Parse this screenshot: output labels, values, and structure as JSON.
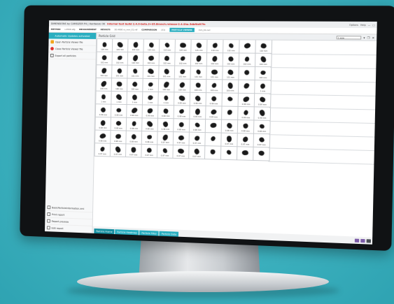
{
  "titlebar": {
    "title": "DIMENSIONS by CAMSIZER P4 | Hardware OK",
    "warning": "internal test build 2.4.0-beta.3+35.Branch.release-2.4.Sha.5dbf0d97fc",
    "options": "Options",
    "help": "Help"
  },
  "menubar": {
    "method_label": "METHOD",
    "method_value": "v.4500.afg",
    "measurement_label": "MEASUREMENT",
    "results_label": "RESULTS",
    "results_value": "20.4900 rs_mm_01.rdf",
    "comparison_label": "COMPARISON",
    "comparison_value": "(31)",
    "active_tab": "PARTICLE VIEWER",
    "active_file": "mm_01.rsd"
  },
  "sidebar": {
    "header": "Automatic Updates activated",
    "items": [
      {
        "label": "Open Particle Viewer file",
        "icon": "folder-icon"
      },
      {
        "label": "Close Particle Viewer file",
        "icon": "close-icon"
      },
      {
        "label": "Export all particles",
        "icon": "export-icon"
      }
    ],
    "bottom_items": [
      {
        "label": "BasicParticleInformation.xml",
        "icon": "document-icon"
      },
      {
        "label": "Print report",
        "icon": "print-icon"
      },
      {
        "label": "Report preview",
        "icon": "preview-icon"
      },
      {
        "label": "Edit report",
        "icon": "edit-icon"
      }
    ]
  },
  "main": {
    "title": "Particle Grid",
    "zoom_value": "1 size",
    "cell_labels": [
      "104 mm",
      "104 mm",
      "102 mm",
      "110 mm",
      "110 mm",
      "104 mm",
      "115 mm",
      "119 mm",
      "132 mm",
      "",
      "102 mm",
      "102 mm",
      "102 mm",
      "102 mm",
      "102 mm",
      "102 mm",
      "102 mm",
      "102 mm",
      "102 mm",
      "102 mm",
      "102 mm",
      "102 mm",
      "102 mm",
      "101 mm",
      "101 mm",
      "101 mm",
      "101 mm",
      "101 mm",
      "101 mm",
      "101 mm",
      "101 mm",
      "",
      "100 mm",
      "100 mm",
      "100 mm",
      "100 mm",
      "1 mm",
      "100 mm",
      "100 mm",
      "100 mm",
      "100 mm",
      "100 mm",
      "",
      "1 mm",
      "1 mm",
      "1 mm",
      "1 mm",
      "1 mm",
      "1 mm",
      "0.99 mm",
      "0.99 mm",
      "0.99 mm",
      "",
      "0.99 mm",
      "0.99 mm",
      "0.99 mm",
      "0.99 mm",
      "0.99 mm",
      "0.99 mm",
      "0.99 mm",
      "0.99 mm",
      "0.99 mm",
      "0.99 mm",
      "",
      "0.99 mm",
      "0.99 mm",
      "0.98 mm",
      "0.98 mm",
      "0.98 mm",
      "0.98 mm",
      "0.98 mm",
      "0.98 mm",
      "0.98 mm",
      "",
      "0.98 mm",
      "0.98 mm",
      "0.98 mm",
      "0.98 mm",
      "0.98 mm",
      "0.98 mm",
      "0.98 mm",
      "0.97 mm",
      "0.97 mm",
      "0.97 mm",
      "",
      "0.97 mm",
      "0.97 mm",
      "0.97 mm",
      "0.97 mm",
      "0.97 mm",
      "0.97 mm",
      "0.97 mm",
      "0.97 mm",
      "0.97 mm",
      "0.97 mm",
      ""
    ]
  },
  "tabs": [
    {
      "label": "Particle Frame"
    },
    {
      "label": "Particle Heatmap"
    },
    {
      "label": "Particle Filter"
    },
    {
      "label": "Particle Data"
    }
  ]
}
